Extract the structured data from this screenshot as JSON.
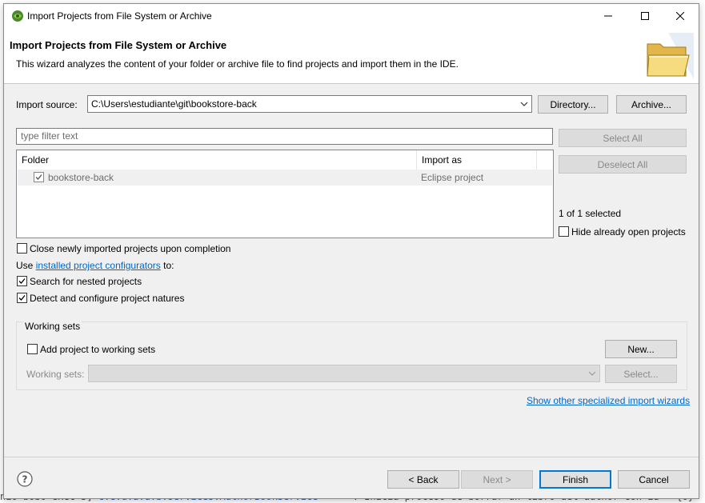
{
  "window": {
    "title": "Import Projects from File System or Archive"
  },
  "header": {
    "title": "Import Projects from File System or Archive",
    "description": "This wizard analyzes the content of your folder or archive file to find projects and import them in the IDE."
  },
  "import_source": {
    "label": "Import source:",
    "value": "C:\\Users\\estudiante\\git\\bookstore-back",
    "directory_button": "Directory...",
    "archive_button": "Archive..."
  },
  "filter": {
    "placeholder": "type filter text"
  },
  "buttons": {
    "select_all": "Select All",
    "deselect_all": "Deselect All"
  },
  "table": {
    "columns": [
      "Folder",
      "Import as"
    ],
    "rows": [
      {
        "folder": "bookstore-back",
        "import_as": "Eclipse project",
        "checked": true
      }
    ]
  },
  "selection_count": "1 of 1 selected",
  "hide_open": {
    "label": "Hide already open projects",
    "checked": false
  },
  "options": {
    "close_imported": {
      "label": "Close newly imported projects upon completion",
      "checked": false
    },
    "use_prefix": "Use",
    "configurators_link": "installed project configurators",
    "use_suffix": "to:",
    "search_nested": {
      "label": "Search for nested projects",
      "checked": true
    },
    "detect_natures": {
      "label": "Detect and configure project natures",
      "checked": true
    }
  },
  "working_sets": {
    "group_title": "Working sets",
    "add_label": "Add project to working sets",
    "add_checked": false,
    "new_button": "New...",
    "sets_label": "Working sets:",
    "select_button": "Select..."
  },
  "other_wizards_link": "Show other specialized import wizards",
  "footer": {
    "back": "< Back",
    "next": "Next >",
    "finish": "Finish",
    "cancel": "Cancel"
  },
  "background": {
    "bottom_text_left": "nio bobo exec 3]",
    "bottom_text_mid": "c.e.u.a.d.b.services.AuthorBookService",
    "bottom_text_right": ": Inicia proceso de borrar un libro del author con id = {0}"
  },
  "colors": {
    "accent": "#0078d7",
    "link": "#0066cc",
    "dialog_bg": "#f0f0f0"
  }
}
